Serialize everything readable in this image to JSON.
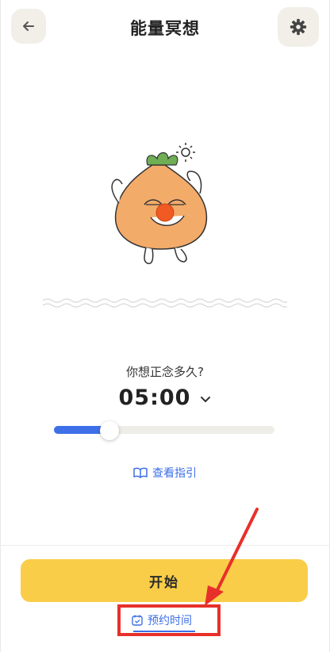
{
  "header": {
    "title": "能量冥想",
    "back_icon": "arrow-left-icon",
    "settings_icon": "gear-icon"
  },
  "meditation": {
    "question": "你想正念多久?",
    "duration": "05:00",
    "slider_progress": 0.25
  },
  "guide": {
    "label": "查看指引",
    "icon": "book-icon"
  },
  "actions": {
    "start_label": "开始",
    "schedule_label": "预约时间",
    "schedule_icon": "calendar-icon"
  },
  "colors": {
    "accent_blue": "#3d6fe8",
    "start_yellow": "#f9cd48",
    "annotation_red": "#e8302a",
    "mascot_orange": "#f3ab6a"
  }
}
